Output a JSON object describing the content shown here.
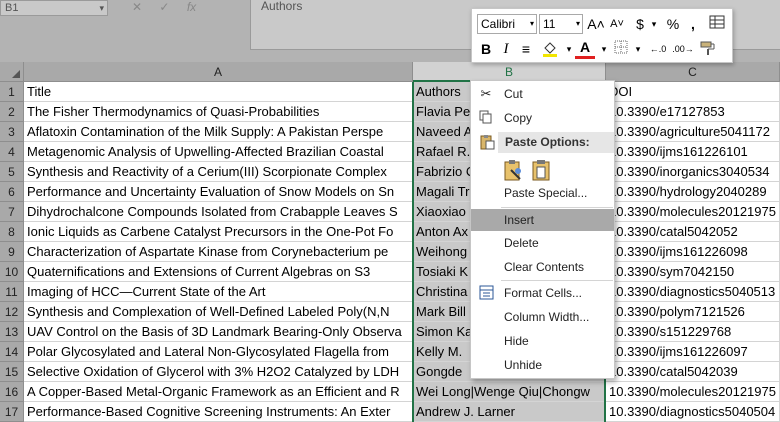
{
  "name_box": {
    "value": "B1"
  },
  "formula_bar": {
    "value": "Authors",
    "fx": "fx"
  },
  "columns": [
    "A",
    "B",
    "C"
  ],
  "rows": [
    {
      "n": "1",
      "a": "Title",
      "b": "Authors",
      "c": "DOI"
    },
    {
      "n": "2",
      "a": "The Fisher Thermodynamics of Quasi-Probabilities",
      "b": "Flavia Pe",
      "c": "10.3390/e17127853"
    },
    {
      "n": "3",
      "a": "Aflatoxin Contamination of the Milk Supply: A Pakistan Perspe",
      "b": "Naveed A",
      "c": "10.3390/agriculture5041172"
    },
    {
      "n": "4",
      "a": "Metagenomic Analysis of Upwelling-Affected Brazilian Coastal",
      "b": "Rafael R.",
      "c": "10.3390/ijms161226101"
    },
    {
      "n": "5",
      "a": "Synthesis and Reactivity of a Cerium(III) Scorpionate Complex",
      "b": "Fabrizio C",
      "c": "10.3390/inorganics3040534"
    },
    {
      "n": "6",
      "a": "Performance and Uncertainty Evaluation of Snow Models on Sn",
      "b": "Magali Tr",
      "c": "10.3390/hydrology2040289"
    },
    {
      "n": "7",
      "a": "Dihydrochalcone Compounds Isolated from Crabapple Leaves S",
      "b": "Xiaoxiao",
      "c": "10.3390/molecules20121975"
    },
    {
      "n": "8",
      "a": "Ionic Liquids as Carbene Catalyst Precursors in the One-Pot Fo",
      "b": "Anton Ax",
      "c": "10.3390/catal5042052"
    },
    {
      "n": "9",
      "a": "Characterization of Aspartate Kinase from Corynebacterium pe",
      "b": "Weihong",
      "c": "10.3390/ijms161226098"
    },
    {
      "n": "10",
      "a": "Quaternifications and Extensions of Current Algebras on S3",
      "b": "Tosiaki K",
      "c": "10.3390/sym7042150"
    },
    {
      "n": "11",
      "a": "Imaging of HCC—Current State of the Art",
      "b": "Christina",
      "c": "10.3390/diagnostics5040513"
    },
    {
      "n": "12",
      "a": "Synthesis and Complexation of Well-Defined Labeled Poly(N,N",
      "b": "Mark Bill",
      "c": "10.3390/polym7121526"
    },
    {
      "n": "13",
      "a": "UAV Control on the Basis of 3D Landmark Bearing-Only Observa",
      "b": "Simon Ka",
      "c": "10.3390/s151229768"
    },
    {
      "n": "14",
      "a": "Polar Glycosylated and Lateral Non-Glycosylated Flagella from",
      "b": "Kelly M.",
      "c": "10.3390/ijms161226097"
    },
    {
      "n": "15",
      "a": "Selective Oxidation of Glycerol with 3% H2O2 Catalyzed by LDH",
      "b": "Gongde",
      "c": "10.3390/catal5042039"
    },
    {
      "n": "16",
      "a": "A Copper-Based Metal-Organic Framework as an Efficient and R",
      "b": "Wei Long|Wenge Qiu|Chongw",
      "c": "10.3390/molecules20121975"
    },
    {
      "n": "17",
      "a": "Performance-Based Cognitive Screening Instruments: An Exter",
      "b": "Andrew J. Larner",
      "c": "10.3390/diagnostics5040504"
    }
  ],
  "mini_toolbar": {
    "font": "Calibri",
    "size": "11",
    "grow": "A˄",
    "shrink": "A˅",
    "currency": "$",
    "percent": "%",
    "comma": ",",
    "bold": "B",
    "italic": "I",
    "align": "≡",
    "font_color_letter": "A",
    "inc_decimal": "←.0",
    "dec_decimal": ".00→"
  },
  "context_menu": {
    "cut": "Cut",
    "copy": "Copy",
    "paste_options": "Paste Options:",
    "paste_special": "Paste Special...",
    "insert": "Insert",
    "delete": "Delete",
    "clear_contents": "Clear Contents",
    "format_cells": "Format Cells...",
    "column_width": "Column Width...",
    "hide": "Hide",
    "unhide": "Unhide"
  },
  "colors": {
    "selection_border": "#217346",
    "highlight": "#a9a9a9",
    "font_color": "#e02020",
    "fill_color": "#f2e600"
  }
}
